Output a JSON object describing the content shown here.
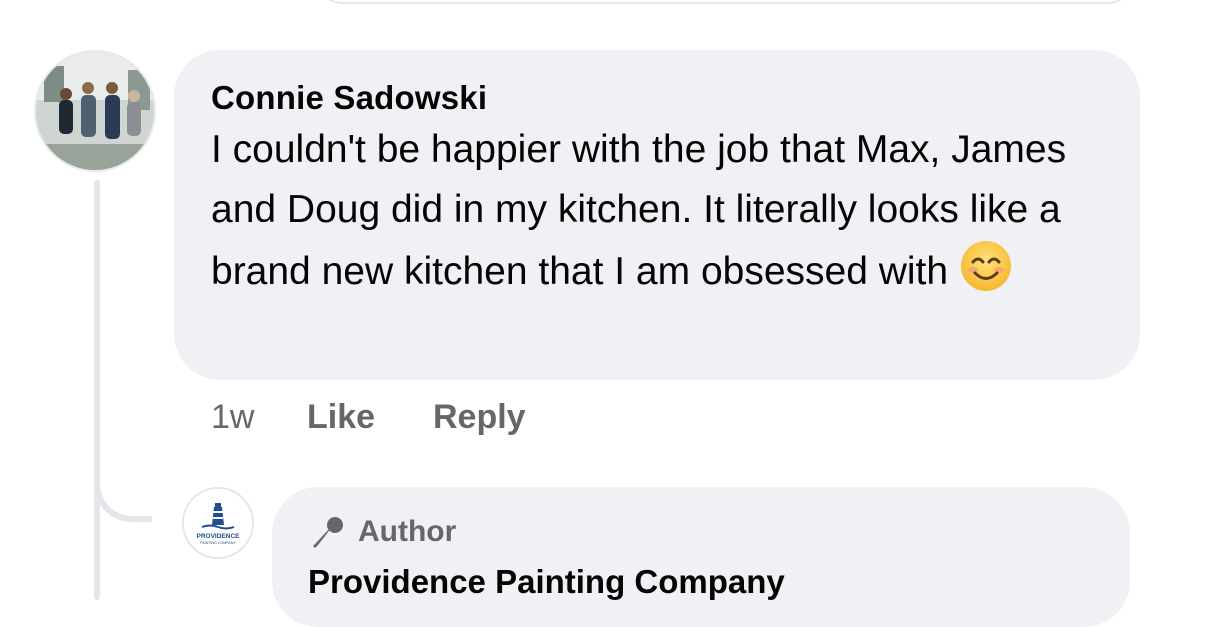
{
  "comment": {
    "author": "Connie Sadowski",
    "text": "I couldn't be happier with the job that Max, James and Doug did in my kitchen.  It literally looks like a brand new kitchen that I am obsessed with",
    "emoji": "smiling-face-with-smiling-eyes"
  },
  "actions": {
    "timestamp": "1w",
    "like_label": "Like",
    "reply_label": "Reply"
  },
  "reply": {
    "badge_label": "Author",
    "badge_icon": "microphone-icon",
    "author": "Providence Painting Company",
    "logo_text": "PROVIDENCE",
    "logo_subtext": "PAINTING COMPANY"
  },
  "colors": {
    "bubble": "#f0f1f5",
    "secondary_text": "#65676b",
    "thread_line": "#e4e6eb",
    "logo_blue": "#1f4f8f"
  }
}
